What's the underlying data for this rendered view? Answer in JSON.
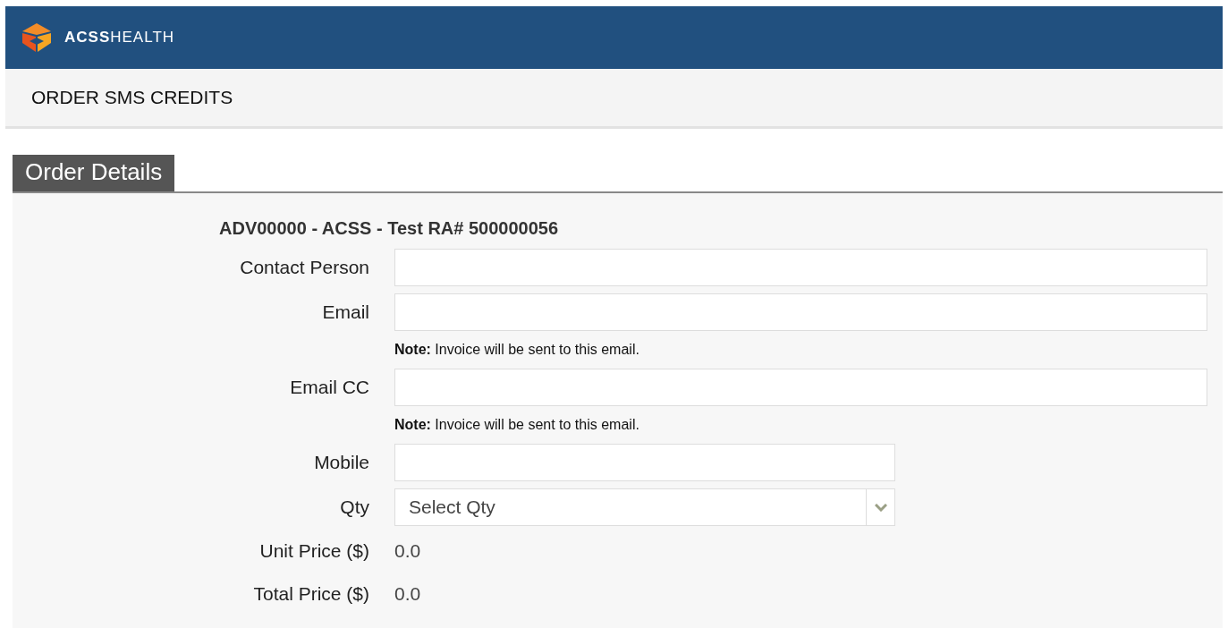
{
  "header": {
    "logo_text": "**ACSS**HEALTH"
  },
  "page_title": "ORDER SMS CREDITS",
  "section": {
    "tab_label": "Order Details",
    "account": "ADV00000 - ACSS - Test RA# 500000056",
    "fields": [
      {
        "kind": "wide-input",
        "label": "Contact Person"
      },
      {
        "kind": "wide-input",
        "label": "Email",
        "note": "**Note:** Invoice will be sent to this email."
      },
      {
        "kind": "wide-input",
        "label": "Email CC",
        "note": "**Note:** Invoice will be sent to this email."
      },
      {
        "kind": "input",
        "label": "Mobile"
      },
      {
        "kind": "select",
        "label": "Qty",
        "value": "Select Qty"
      },
      {
        "kind": "readout",
        "label": "Unit Price ($)",
        "value": "0.0"
      },
      {
        "kind": "readout",
        "label": "Total Price ($)",
        "value": "0.0"
      }
    ]
  }
}
